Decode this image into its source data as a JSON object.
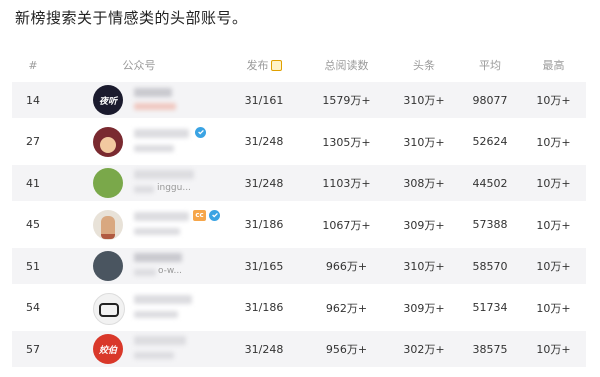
{
  "intro": "新榜搜索关于情感类的头部账号。",
  "headers": {
    "idx": "#",
    "account": "公众号",
    "published": "发布",
    "total_reads": "总阅读数",
    "headline": "头条",
    "average": "平均",
    "max": "最高"
  },
  "rows": [
    {
      "idx": "14",
      "published": "31/161",
      "total_reads": "1579万+",
      "headline": "310万+",
      "average": "98077",
      "max": "10万+",
      "avatar_text": "夜听",
      "avatar_color": "#1b1b2e"
    },
    {
      "idx": "27",
      "published": "31/248",
      "total_reads": "1305万+",
      "headline": "310万+",
      "average": "52624",
      "max": "10万+",
      "avatar_color": "#7a2a30"
    },
    {
      "idx": "41",
      "published": "31/248",
      "total_reads": "1103万+",
      "headline": "308万+",
      "average": "44502",
      "max": "10万+",
      "avatar_text": "",
      "avatar_color": "#7aa84a",
      "partial_text": "inggu..."
    },
    {
      "idx": "45",
      "published": "31/186",
      "total_reads": "1067万+",
      "headline": "309万+",
      "average": "57388",
      "max": "10万+",
      "avatar_color": "#e8e2d8"
    },
    {
      "idx": "51",
      "published": "31/165",
      "total_reads": "966万+",
      "headline": "310万+",
      "average": "58570",
      "max": "10万+",
      "avatar_color": "#4a5560",
      "partial_text": "o-w..."
    },
    {
      "idx": "54",
      "published": "31/186",
      "total_reads": "962万+",
      "headline": "309万+",
      "average": "51734",
      "max": "10万+",
      "avatar_color": "#f2f2f2"
    },
    {
      "idx": "57",
      "published": "31/248",
      "total_reads": "956万+",
      "headline": "302万+",
      "average": "38575",
      "max": "10万+",
      "avatar_text": "姣伯",
      "avatar_color": "#d9382a"
    }
  ],
  "colors": {
    "row_shade": "#f4f4f6",
    "header_text": "#9a9a9a",
    "verified": "#3aa3e3",
    "badge": "#f6a64a"
  },
  "icons": {
    "published_header": "cookie-icon",
    "verified": "check-badge-icon"
  }
}
